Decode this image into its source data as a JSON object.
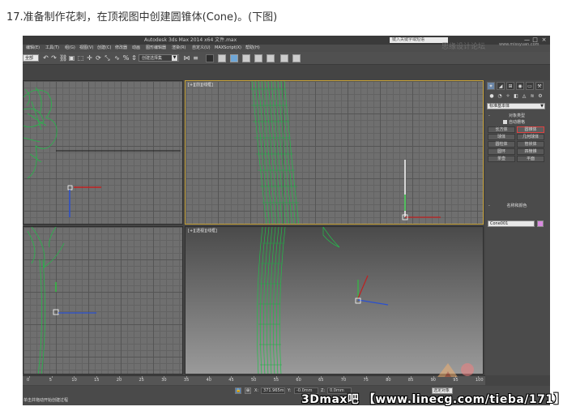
{
  "caption": "17.准备制作花刺，在顶视图中创建圆锥体(Cone)。(下图)",
  "app": {
    "title": "Autodesk 3ds Max 2014 x64    文件.max",
    "search_placeholder": "键入关键字或短语",
    "window_buttons": [
      "—",
      "□",
      "×"
    ],
    "menus": [
      "编辑(E)",
      "工具(T)",
      "组(G)",
      "视图(V)",
      "创建(C)",
      "修改器",
      "动画",
      "图形编辑器",
      "渲染(R)",
      "自定义(U)",
      "MAXScript(X)",
      "帮助(H)"
    ]
  },
  "toolbar": {
    "selection_set": "全部",
    "view_dropdown": "创建选择集",
    "icons": [
      "undo-icon",
      "redo-icon",
      "link-icon",
      "unlink-icon",
      "bind-icon",
      "select-icon",
      "select-region-icon",
      "move-icon",
      "rotate-icon",
      "scale-icon",
      "snap-icon",
      "percent-snap-icon",
      "mirror-icon",
      "align-icon"
    ]
  },
  "viewports": {
    "top_left_label": "",
    "top_right_label": "[+][前][线框]",
    "bottom_left_label": "",
    "bottom_right_label": "[+][透视][线框]"
  },
  "command_panel": {
    "tabs": [
      "create-tab",
      "modify-tab",
      "hierarchy-tab",
      "motion-tab",
      "display-tab",
      "utilities-tab"
    ],
    "category": "标准基本体",
    "object_type_header": "对象类型",
    "autogrid_label": "自动栅格",
    "buttons": [
      [
        "长方体",
        "圆锥体"
      ],
      [
        "球体",
        "几何球体"
      ],
      [
        "圆柱体",
        "管状体"
      ],
      [
        "圆环",
        "四棱锥"
      ],
      [
        "茶壶",
        "平面"
      ]
    ],
    "highlighted_button": "圆锥体",
    "name_color_header": "名称和颜色",
    "object_name": "Cone001",
    "object_color": "#d98ae0"
  },
  "timeline": {
    "ticks": [
      "0",
      "5",
      "10",
      "15",
      "20",
      "25",
      "30",
      "35",
      "40",
      "45",
      "50",
      "55",
      "60",
      "65",
      "70",
      "75",
      "80",
      "85",
      "90",
      "95",
      "100"
    ]
  },
  "status": {
    "prompt": "单击并拖动开始创建过程",
    "x_label": "X:",
    "x_value": "371.965mm",
    "y_label": "Y:",
    "y_value": "-0.0mm",
    "z_label": "Z:",
    "z_value": "0.0mm",
    "selected_filter": "选定对象"
  },
  "watermarks": {
    "top": "思缘设计论坛",
    "top_url": "www.missyuan.com",
    "bottom": "3Dmax吧 【www.linecg.com/tieba/171】"
  }
}
